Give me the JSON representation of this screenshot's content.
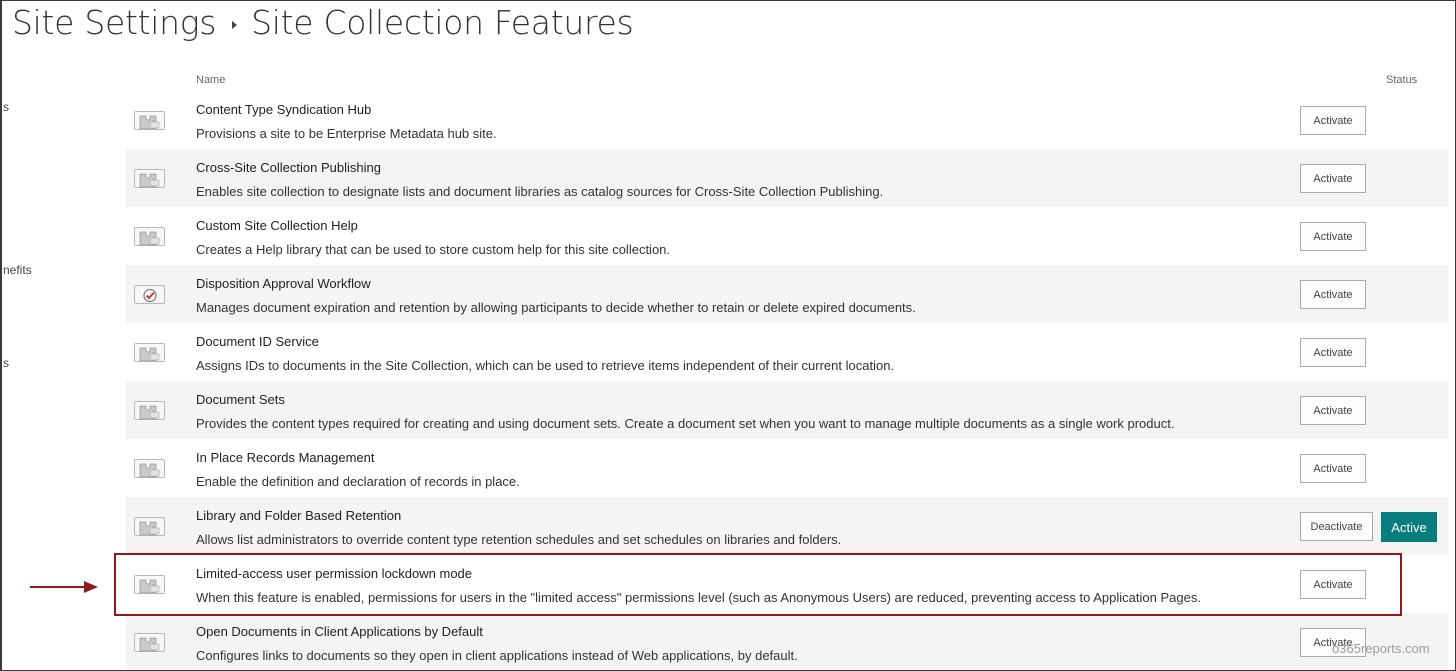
{
  "header": {
    "breadcrumb_parent": "Site Settings",
    "breadcrumb_current": "Site Collection Features"
  },
  "left_nav": {
    "fragments": [
      "s",
      "nefits",
      "s"
    ]
  },
  "table": {
    "col_name": "Name",
    "col_status": "Status"
  },
  "features": [
    {
      "title": "Content Type Syndication Hub",
      "description": "Provisions a site to be Enterprise Metadata hub site.",
      "icon": "feature-puzzle-icon",
      "button": "Activate",
      "status": ""
    },
    {
      "title": "Cross-Site Collection Publishing",
      "description": "Enables site collection to designate lists and document libraries as catalog sources for Cross-Site Collection Publishing.",
      "icon": "feature-puzzle-icon",
      "button": "Activate",
      "status": ""
    },
    {
      "title": "Custom Site Collection Help",
      "description": "Creates a Help library that can be used to store custom help for this site collection.",
      "icon": "feature-puzzle-icon",
      "button": "Activate",
      "status": ""
    },
    {
      "title": "Disposition Approval Workflow",
      "description": "Manages document expiration and retention by allowing participants to decide whether to retain or delete expired documents.",
      "icon": "workflow-check-icon",
      "button": "Activate",
      "status": ""
    },
    {
      "title": "Document ID Service",
      "description": "Assigns IDs to documents in the Site Collection, which can be used to retrieve items independent of their current location.",
      "icon": "feature-puzzle-icon",
      "button": "Activate",
      "status": ""
    },
    {
      "title": "Document Sets",
      "description": "Provides the content types required for creating and using document sets. Create a document set when you want to manage multiple documents as a single work product.",
      "icon": "feature-puzzle-icon",
      "button": "Activate",
      "status": ""
    },
    {
      "title": "In Place Records Management",
      "description": "Enable the definition and declaration of records in place.",
      "icon": "feature-puzzle-icon",
      "button": "Activate",
      "status": ""
    },
    {
      "title": "Library and Folder Based Retention",
      "description": "Allows list administrators to override content type retention schedules and set schedules on libraries and folders.",
      "icon": "feature-puzzle-icon",
      "button": "Deactivate",
      "status": "Active"
    },
    {
      "title": "Limited-access user permission lockdown mode",
      "description": "When this feature is enabled, permissions for users in the \"limited access\" permissions level (such as Anonymous Users) are reduced, preventing access to Application Pages.",
      "icon": "feature-puzzle-icon",
      "button": "Activate",
      "status": ""
    },
    {
      "title": "Open Documents in Client Applications by Default",
      "description": "Configures links to documents so they open in client applications instead of Web applications, by default.",
      "icon": "feature-puzzle-icon",
      "button": "Activate",
      "status": ""
    }
  ],
  "colors": {
    "active_badge": "#077d7d",
    "highlight_border": "#8e1b1b",
    "arrow": "#8e1b1b"
  },
  "watermark": "o365reports.com"
}
